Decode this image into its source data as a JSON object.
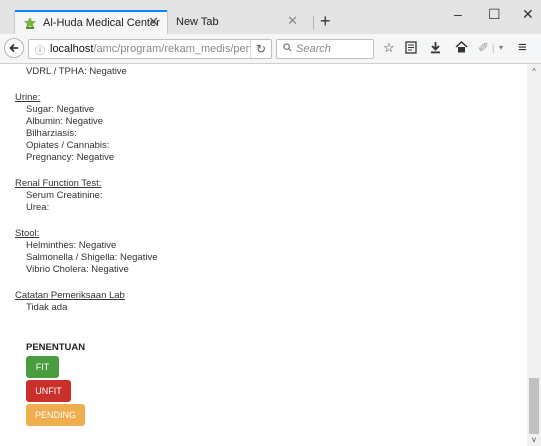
{
  "browser": {
    "tabs": [
      {
        "title": "Al-Huda Medical Center",
        "active": true
      },
      {
        "title": "New Tab",
        "active": false
      }
    ],
    "new_tab_label": "+",
    "window_controls": {
      "minimize": "–",
      "maximize": "☐",
      "close": "✕"
    },
    "url": {
      "host": "localhost",
      "path": "/amc/program/rekam_medis/pen"
    },
    "search_placeholder": "Search",
    "accent_color": "#0a84ff"
  },
  "page": {
    "top_partial_line": "VDRL / TPHA: Negative",
    "sections": [
      {
        "heading": "Urine:",
        "items": [
          "Sugar: Negative",
          "Albumin: Negative",
          "Bilharziasis:",
          "Opiates / Cannabis:",
          "Pregnancy: Negative"
        ]
      },
      {
        "heading": "Renal Function Test:",
        "items": [
          "Serum Creatinine:",
          "Urea:"
        ]
      },
      {
        "heading": "Stool:",
        "items": [
          "Helminthes: Negative",
          "Salmonella / Shigella: Negative",
          "Vibrio Cholera: Negative"
        ]
      },
      {
        "heading": "Catatan Pemeriksaan Lab",
        "items": [
          "Tidak ada"
        ]
      }
    ],
    "decision_title": "PENENTUAN",
    "buttons": [
      {
        "label": "FIT",
        "color": "#4a9d3f"
      },
      {
        "label": "UNFIT",
        "color": "#c9302c"
      },
      {
        "label": "PENDING",
        "color": "#f0ad4e"
      }
    ]
  }
}
